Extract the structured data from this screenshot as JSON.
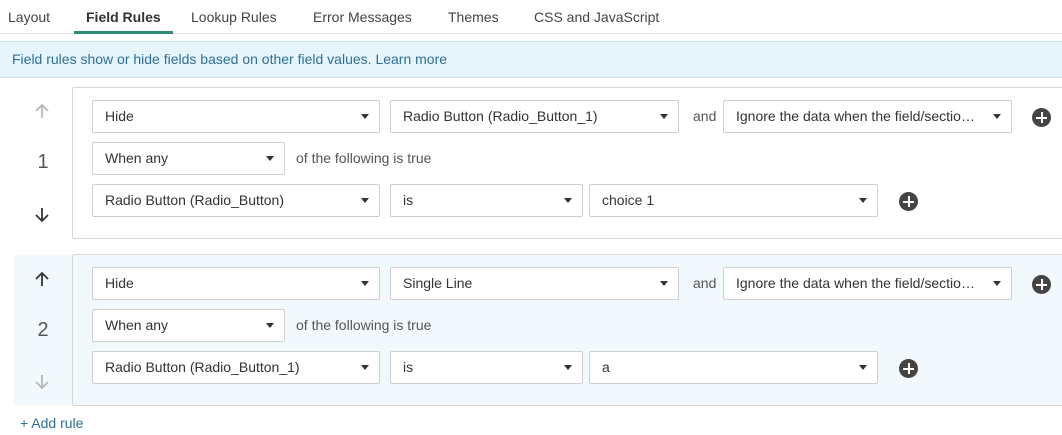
{
  "tabs": [
    {
      "label": "Layout"
    },
    {
      "label": "Field Rules"
    },
    {
      "label": "Lookup Rules"
    },
    {
      "label": "Error Messages"
    },
    {
      "label": "Themes"
    },
    {
      "label": "CSS and JavaScript"
    }
  ],
  "info": {
    "text": "Field rules show or hide fields based on other field values.",
    "link": "Learn more"
  },
  "rules": [
    {
      "number": "1",
      "action": "Hide",
      "target": "Radio Button (Radio_Button_1)",
      "and_label": "and",
      "data_option": "Ignore the data when the field/section is hidden",
      "match": "When any",
      "match_suffix": "of the following is true",
      "condition": {
        "field": "Radio Button (Radio_Button)",
        "operator": "is",
        "value": "choice 1"
      }
    },
    {
      "number": "2",
      "action": "Hide",
      "target": "Single Line",
      "and_label": "and",
      "data_option": "Ignore the data when the field/section is hidden",
      "match": "When any",
      "match_suffix": "of the following is true",
      "condition": {
        "field": "Radio Button (Radio_Button_1)",
        "operator": "is",
        "value": "a"
      }
    }
  ],
  "add_rule_label": "+ Add rule"
}
